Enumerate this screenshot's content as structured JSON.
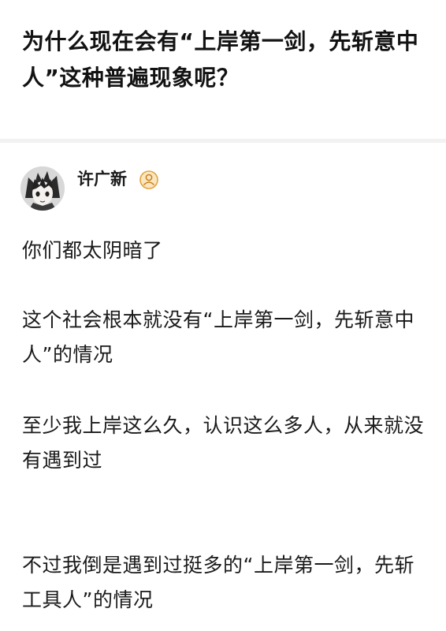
{
  "question": {
    "title": "为什么现在会有“上岸第一剑，先斩意中人”这种普遍现象呢？"
  },
  "answer": {
    "author": {
      "name": "许广新",
      "avatar_icon": "anime-avatar-icon",
      "badge_icon": "user-badge-icon"
    },
    "paragraphs": [
      "你们都太阴暗了",
      "这个社会根本就没有“上岸第一剑，先斩意中人”的情况",
      "至少我上岸这么久，认识这么多人，从来就没有遇到过",
      "不过我倒是遇到过挺多的“上岸第一剑，先斩工具人”的情况"
    ]
  },
  "colors": {
    "text": "#1a1a1a",
    "divider": "#f2f2f2",
    "badge": "#e2a33b"
  }
}
